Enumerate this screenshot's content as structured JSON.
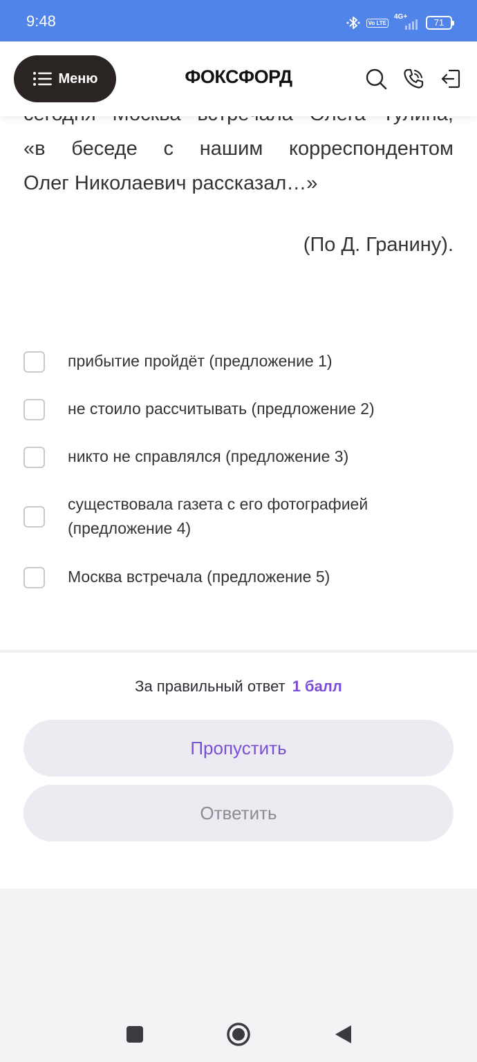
{
  "status_bar": {
    "time": "9:48",
    "volte": "Vo LTE",
    "network": "4G+",
    "battery": "71"
  },
  "header": {
    "menu_label": "Меню",
    "logo": "ФОКСФОРД",
    "icons": [
      "search-icon",
      "phone-icon",
      "logout-icon"
    ]
  },
  "passage": {
    "line_cut": [
      "сегодня",
      "Москва",
      "встречала",
      "Олега",
      "Тулина,"
    ],
    "line2": [
      "«в",
      "беседе",
      "с",
      "нашим",
      "корреспондентом"
    ],
    "line3": "Олег Николаевич рассказал…»",
    "attribution": "(По Д. Гранину)."
  },
  "options": [
    {
      "text": "прибытие пройдёт (предложение 1)",
      "checked": false
    },
    {
      "text": "не стоило рассчитывать (предложение 2)",
      "checked": false
    },
    {
      "text": "никто не справлялся (предложение 3)",
      "checked": false
    },
    {
      "text": "существовала газета с его фотографией (предложение 4)",
      "checked": false
    },
    {
      "text": "Москва встречала (предложение 5)",
      "checked": false
    }
  ],
  "score": {
    "label": "За правильный ответ",
    "points": "1 балл"
  },
  "buttons": {
    "skip": "Пропустить",
    "answer": "Ответить"
  },
  "colors": {
    "status_bar": "#5184e8",
    "accent": "#7a4fd6",
    "menu_button": "#2a2522",
    "button_bg": "#ebebf1"
  },
  "nav_bar": [
    "recent-apps-icon",
    "home-icon",
    "back-icon"
  ]
}
